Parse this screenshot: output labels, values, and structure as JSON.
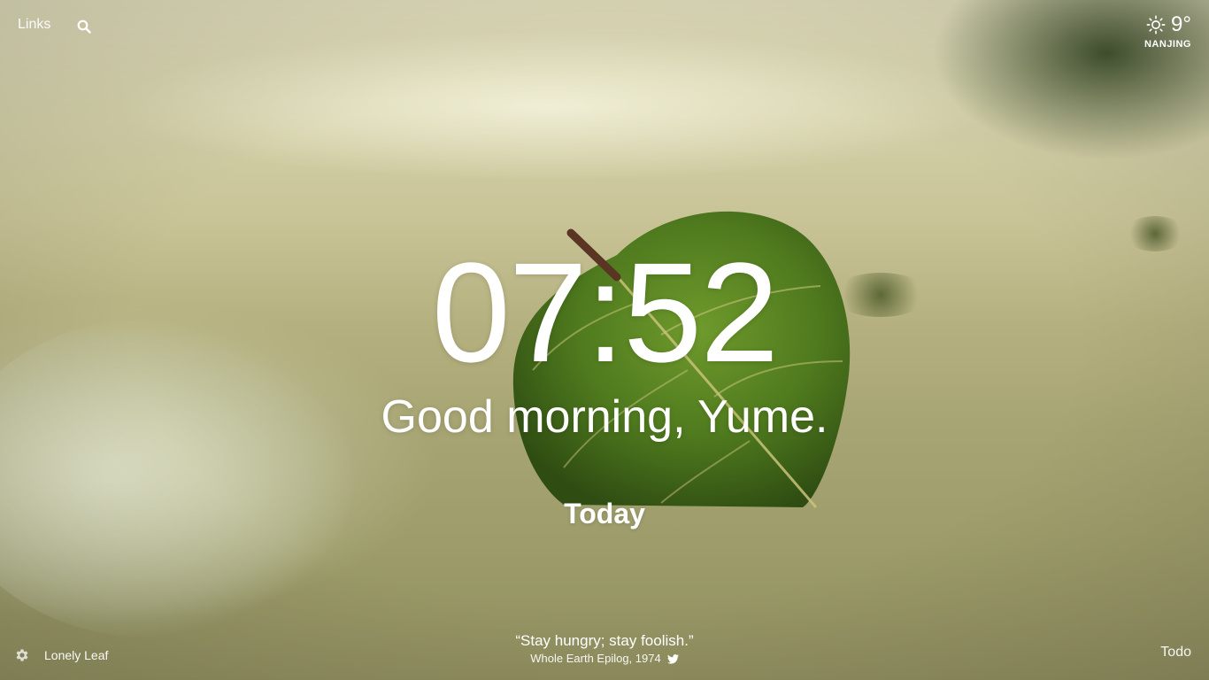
{
  "top_left": {
    "links_label": "Links",
    "search_icon": "search-icon"
  },
  "weather": {
    "icon": "sun-icon",
    "temperature": "9°",
    "city": "NANJING"
  },
  "main": {
    "time": "07:52",
    "greeting": "Good morning, Yume.",
    "focus_label": "Today"
  },
  "bottom_left": {
    "settings_icon": "gear-icon",
    "photo_name": "Lonely Leaf"
  },
  "quote": {
    "text": "“Stay hungry; stay foolish.”",
    "source": "Whole Earth Epilog, 1974",
    "share_icon": "twitter-icon"
  },
  "todo_label": "Todo",
  "colors": {
    "text": "#ffffff",
    "leaf_green": "#4f7a1e",
    "sand": "#b5b07f"
  }
}
